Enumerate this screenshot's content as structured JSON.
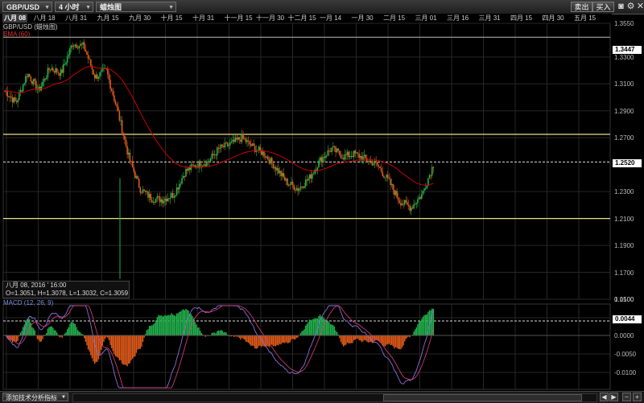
{
  "toolbar": {
    "symbol": "GBP/USD",
    "timeframe": "4 小时",
    "chart_type": "蜡烛图",
    "sell_label": "卖出",
    "buy_label": "买入",
    "icons": [
      "camera-icon",
      "settings-icon",
      "close-icon"
    ]
  },
  "date_axis": [
    "八月 08",
    "八月 18",
    "八月 31",
    "九月 15",
    "九月 30",
    "十月 15",
    "十月 31",
    "十一月 15",
    "十一月 30",
    "十二月 15",
    "一月 14",
    "一月 30",
    "二月 15",
    "三月 01",
    "三月 16",
    "三月 31",
    "四月 15",
    "四月 30",
    "五月 15"
  ],
  "legend": {
    "title": "GBP/USD (蜡烛图)",
    "ema": "EMA (60)",
    "macd": "MACD (12, 26, 9)"
  },
  "info_box": {
    "date": "八月 08, 2016 ' 16:00",
    "ohlc": "O=1.3051, H=1.3078, L=1.3032, C=1.3059"
  },
  "price_axis": {
    "labels": [
      "1.3550",
      "1.3300",
      "1.3100",
      "1.2900",
      "1.2700",
      "1.2300",
      "1.2100",
      "1.1900",
      "1.1700",
      "1.1500"
    ],
    "highlight_top": "1.3447",
    "highlight_current": "1.2520"
  },
  "macd_axis": {
    "labels": [
      "0.0100",
      "0.0050",
      "0.0000",
      "-0.0050",
      "-0.0100"
    ],
    "highlight": "0.0044"
  },
  "bottom_bar": {
    "add_indicator": "添加技术分析指标"
  },
  "chart_data": {
    "type": "candlestick",
    "symbol": "GBP/USD",
    "ylim": [
      1.15,
      1.355
    ],
    "horizontal_lines": [
      1.3447,
      1.2725,
      1.252,
      1.21
    ],
    "current_price": 1.252,
    "close_path": [
      1.305,
      1.296,
      1.318,
      1.305,
      1.322,
      1.318,
      1.34,
      1.338,
      1.315,
      1.32,
      1.29,
      1.255,
      1.232,
      1.225,
      1.224,
      1.228,
      1.245,
      1.25,
      1.252,
      1.262,
      1.265,
      1.27,
      1.263,
      1.258,
      1.248,
      1.237,
      1.232,
      1.24,
      1.254,
      1.262,
      1.256,
      1.258,
      1.254,
      1.25,
      1.238,
      1.223,
      1.218,
      1.228,
      1.25
    ]
  },
  "colors": {
    "up": "#22b14c",
    "down": "#e05a1a",
    "ema": "#cc0000",
    "hline": "#e8e08a",
    "macd_line": "#8a6fd8",
    "signal_line": "#e0407a"
  }
}
